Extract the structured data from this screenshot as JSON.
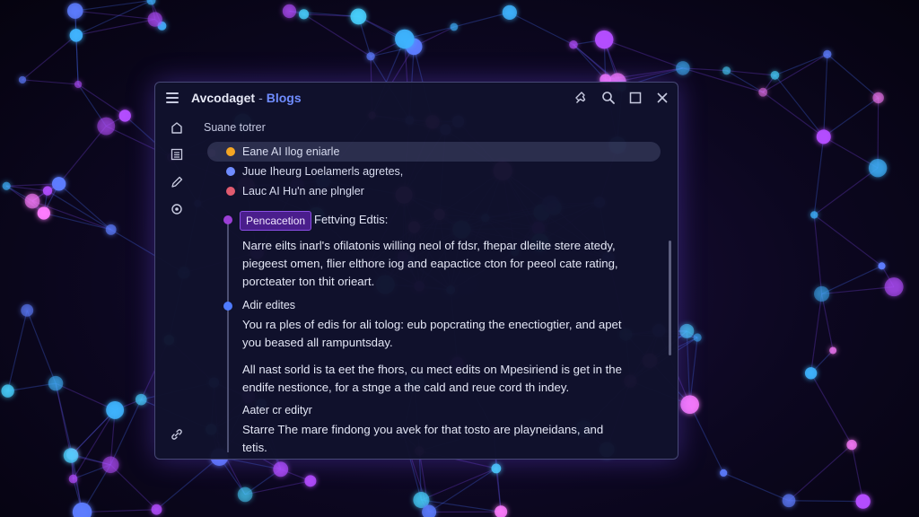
{
  "window": {
    "app_name": "Avcodaget",
    "separator": "-",
    "section": "Blogs",
    "subtitle": "Suane totrer"
  },
  "titlebar_icons": [
    "pin-icon",
    "search-icon",
    "maximize-icon",
    "close-icon"
  ],
  "sidebar_icons": [
    "home-icon",
    "list-icon",
    "edit-icon",
    "settings-icon",
    "link-icon"
  ],
  "list": {
    "items": [
      {
        "label": "Eane AI Ilog eniarle",
        "color": "#f5a623",
        "active": true
      },
      {
        "label": "Juue Iheurg Loelamerls agretes,",
        "color": "#6f8cff",
        "active": false
      },
      {
        "label": "Lauc AI Hu'n ane plngler",
        "color": "#e05b6f",
        "active": false
      }
    ]
  },
  "content": {
    "tag": "Pencacetion",
    "tag_heading": "Fettving Edtis:",
    "para1": [
      "Narre eilts inarl's ofilatonis willing neol of fdsr, fhepar dleilte stere atedy,",
      "piegeest omen, flier elthore iog and eapactice cton for peeol cate rating,",
      "porcteater ton thit orieart."
    ],
    "heading2": "Adir edites",
    "para2": [
      "You ra ples of edis for ali tolog: eub popcrating the enectiogtier, and apet",
      "you beased all rampuntsday."
    ],
    "para3": [
      "All nast sorld is ta eet the fhors, cu mect edits on Mpesiriend is get in the",
      "endife nestionce, for a stnge a the cald and reue cord th indey."
    ],
    "heading3": "Aater cr edityr",
    "para4": [
      "Starre The mare findong you avek for that tosto are playneidans, and",
      "tetis."
    ]
  },
  "colors": {
    "accent": "#6f8cff",
    "tag_bg": "#4a1e8c",
    "timeline_dot_1": "#9b3fd6",
    "timeline_dot_2": "#4f7bff"
  }
}
